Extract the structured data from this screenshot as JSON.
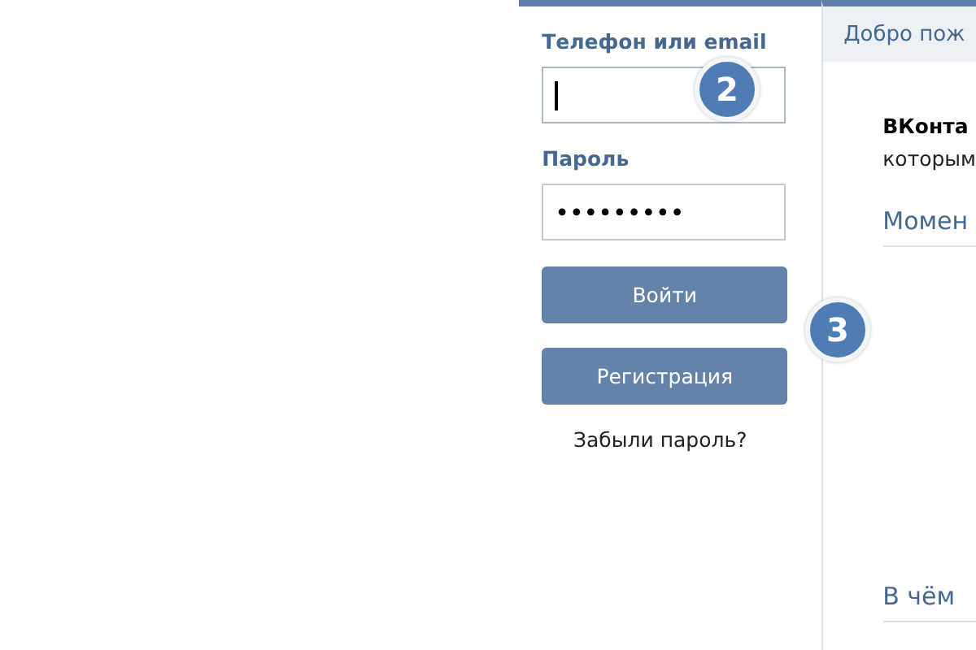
{
  "login": {
    "phone_label": "Телефон или email",
    "phone_field": {
      "focused": true
    },
    "password_label": "Пароль",
    "password_field": {
      "value": "•••••••••",
      "focused": false
    },
    "buttons": [
      {
        "label": "Войти"
      },
      {
        "label": "Регистрация"
      }
    ],
    "forgot_link": "Забыли пароль?"
  },
  "welcome": {
    "header": "Добро пож",
    "intro_bold": "ВКонта",
    "intro_text": "которым",
    "headings": [
      "Момен",
      "В чём"
    ]
  },
  "step_badges": [
    {
      "number": "2"
    },
    {
      "number": "3"
    }
  ]
}
